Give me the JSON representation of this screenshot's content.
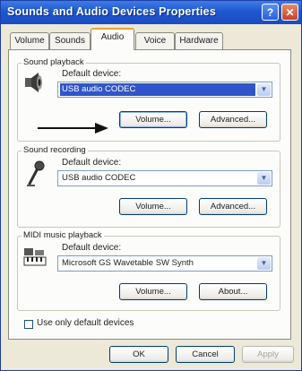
{
  "window": {
    "title": "Sounds and Audio Devices Properties",
    "help_button": "?",
    "close_button": "✕"
  },
  "tabs": [
    {
      "label": "Volume",
      "active": false
    },
    {
      "label": "Sounds",
      "active": false
    },
    {
      "label": "Audio",
      "active": true
    },
    {
      "label": "Voice",
      "active": false
    },
    {
      "label": "Hardware",
      "active": false
    }
  ],
  "sound_playback": {
    "group_label": "Sound playback",
    "default_device_label": "Default device:",
    "device": "USB audio CODEC",
    "volume_button": "Volume...",
    "advanced_button": "Advanced..."
  },
  "sound_recording": {
    "group_label": "Sound recording",
    "default_device_label": "Default device:",
    "device": "USB audio CODEC",
    "volume_button": "Volume...",
    "advanced_button": "Advanced..."
  },
  "midi_playback": {
    "group_label": "MIDI music playback",
    "default_device_label": "Default device:",
    "device": "Microsoft GS Wavetable SW Synth",
    "volume_button": "Volume...",
    "about_button": "About..."
  },
  "use_only_default": {
    "label": "Use only default devices",
    "checked": false
  },
  "footer": {
    "ok_button": "OK",
    "cancel_button": "Cancel",
    "apply_button": "Apply"
  },
  "colors": {
    "titlebar": "#1f57d0",
    "selection": "#2f55c8",
    "active_tab_accent": "#e8a33a"
  }
}
